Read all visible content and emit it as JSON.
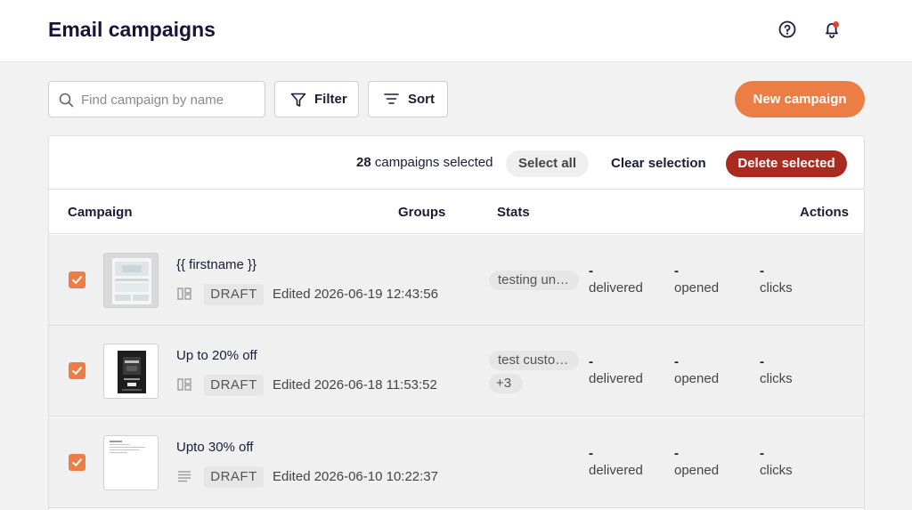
{
  "header": {
    "title": "Email campaigns",
    "help_icon": "help-circle-icon",
    "bell_icon": "bell-icon",
    "notification_dot_color": "#e8412c"
  },
  "toolbar": {
    "search_placeholder": "Find campaign by name",
    "search_value": "",
    "filter_label": "Filter",
    "sort_label": "Sort",
    "new_campaign_label": "New campaign",
    "accent_color": "#ec7d44"
  },
  "selection": {
    "count": "28",
    "count_suffix": "campaigns selected",
    "select_all_label": "Select all",
    "clear_label": "Clear selection",
    "delete_label": "Delete selected",
    "delete_color": "#a82a20"
  },
  "table": {
    "columns": [
      "Campaign",
      "Groups",
      "Stats",
      "Actions"
    ],
    "rows": [
      {
        "name": "{{ firstname }}",
        "status": "DRAFT",
        "edited": "Edited 2026-06-19 12:43:56",
        "type_icon": "layout-blocks-icon",
        "groups": [
          "testing un…"
        ],
        "checked": true,
        "stats": {
          "delivered_value": "-",
          "delivered_label": "delivered",
          "opened_value": "-",
          "opened_label": "opened",
          "clicks_value": "-",
          "clicks_label": "clicks"
        }
      },
      {
        "name": "Up to 20% off",
        "status": "DRAFT",
        "edited": "Edited 2026-06-18 11:53:52",
        "type_icon": "layout-blocks-icon",
        "groups": [
          "test custo…",
          "+3"
        ],
        "checked": true,
        "stats": {
          "delivered_value": "-",
          "delivered_label": "delivered",
          "opened_value": "-",
          "opened_label": "opened",
          "clicks_value": "-",
          "clicks_label": "clicks"
        }
      },
      {
        "name": "Upto 30% off",
        "status": "DRAFT",
        "edited": "Edited 2026-06-10 10:22:37",
        "type_icon": "plain-text-icon",
        "groups": [],
        "checked": true,
        "stats": {
          "delivered_value": "-",
          "delivered_label": "delivered",
          "opened_value": "-",
          "opened_label": "opened",
          "clicks_value": "-",
          "clicks_label": "clicks"
        }
      }
    ]
  }
}
